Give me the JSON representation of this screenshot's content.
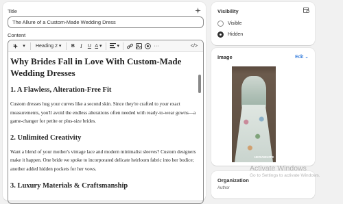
{
  "main": {
    "title_label": "Title",
    "title_value": "The Allure of a Custom-Made Wedding Dress",
    "content_label": "Content",
    "toolbar": {
      "heading_select": "Heading 2",
      "bold": "B",
      "italic": "I",
      "underline": "U",
      "text_color": "A",
      "code": "</>"
    },
    "article": {
      "h1": "Why Brides Fall in Love With Custom-Made Wedding Dresses",
      "s1_heading": "1. A Flawless, Alteration-Free Fit",
      "s1_text": "Custom dresses hug your curves like a second skin. Since they're crafted to your exact measurements, you'll avoid the endless alterations often needed with ready-to-wear gowns—a game-changer for petite or plus-size brides.",
      "s2_heading": "2. Unlimited Creativity",
      "s2_text": "Want a blend of your mother's vintage lace and modern minimalist sleeves? Custom designers make it happen. One bride we spoke to incorporated delicate heirloom fabric into her bodice; another added hidden pockets for her vows.",
      "s3_heading": "3. Luxury Materials & Craftsmanship"
    }
  },
  "visibility": {
    "title": "Visibility",
    "options": [
      "Visible",
      "Hidden"
    ],
    "selected": "Hidden"
  },
  "image": {
    "title": "Image",
    "edit_label": "Edit",
    "brand_text": "HERAWHITE"
  },
  "organization": {
    "title": "Organization",
    "sub": "Author"
  },
  "watermark": {
    "line1": "Activate Windows",
    "line2": "Go to Settings to activate Windows."
  }
}
